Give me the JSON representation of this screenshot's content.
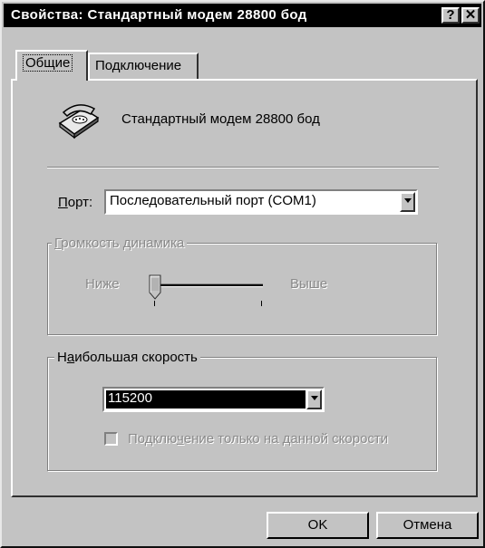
{
  "window": {
    "title": "Свойства: Стандартный модем 28800 бод",
    "help_glyph": "?",
    "close_glyph": "✕"
  },
  "tabs": [
    {
      "label": "Общие",
      "active": true
    },
    {
      "label": "Подключение",
      "active": false
    }
  ],
  "general": {
    "modem_icon": "telephone-icon",
    "modem_name": "Стандартный модем 28800 бод",
    "port_label_hotkey": "П",
    "port_label_rest": "орт:",
    "port_value": "Последовательный порт (COM1)",
    "speaker": {
      "group_hotkey": "Г",
      "group_rest": "ромкость динамика",
      "low_label": "Ниже",
      "high_label": "Выше",
      "disabled": true,
      "level": 0
    },
    "speed": {
      "group_pre": "Н",
      "group_hotkey": "а",
      "group_rest": "ибольшая скорость",
      "value": "115200",
      "only_speed_label_pre": "Подклю",
      "only_speed_label_hotkey": "ч",
      "only_speed_label_rest": "ение только на данной скорости",
      "only_speed_checked": false,
      "only_speed_disabled": true
    }
  },
  "buttons": {
    "ok": "OK",
    "cancel": "Отмена"
  }
}
